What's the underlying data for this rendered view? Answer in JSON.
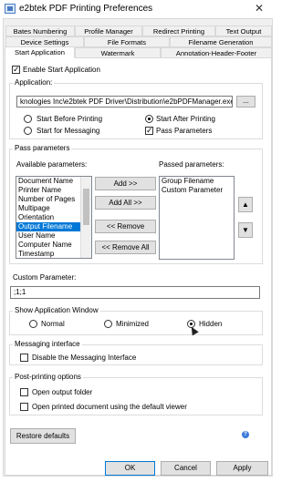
{
  "window": {
    "title": "e2btek PDF Printing Preferences",
    "close": "✕"
  },
  "tabs": {
    "row1": [
      "Bates Numbering",
      "Profile Manager",
      "Redirect Printing",
      "Text Output"
    ],
    "row2": [
      "Device Settings",
      "File Formats",
      "Filename Generation"
    ],
    "row3": [
      "Start Application",
      "Watermark",
      "Annotation-Header-Footer"
    ]
  },
  "enable_start_app": {
    "label": "Enable Start Application",
    "checked": true
  },
  "application": {
    "group_label": "Application:",
    "path": "knologies Inc\\e2btek PDF Driver\\Distribution\\e2bPDFManager.exe",
    "browse": "...",
    "start_before": "Start Before Printing",
    "start_after": "Start After Printing",
    "start_messaging": "Start for Messaging",
    "pass_parameters": "Pass Parameters"
  },
  "pass_params": {
    "group_label": "Pass parameters",
    "available_label": "Available parameters:",
    "passed_label": "Passed parameters:",
    "available": [
      "Document Name",
      "Printer Name",
      "Number of Pages",
      "Multipage",
      "Orientation",
      "Output Filename",
      "User Name",
      "Computer Name",
      "Timestamp"
    ],
    "selected_index": 5,
    "passed": [
      "Group Filename",
      "Custom Parameter"
    ],
    "add": "Add >>",
    "add_all": "Add All >>",
    "remove": "<< Remove",
    "remove_all": "<< Remove All",
    "up": "▲",
    "down": "▼"
  },
  "custom_param": {
    "label": "Custom Parameter:",
    "value": ";1;1"
  },
  "show_window": {
    "group_label": "Show Application Window",
    "normal": "Normal",
    "minimized": "Minimized",
    "hidden": "Hidden"
  },
  "messaging": {
    "group_label": "Messaging interface",
    "disable": "Disable the Messaging Interface"
  },
  "post": {
    "group_label": "Post-printing options",
    "open_folder": "Open output folder",
    "open_doc": "Open printed document using the default viewer"
  },
  "footer": {
    "restore": "Restore defaults",
    "help": "?",
    "ok": "OK",
    "cancel": "Cancel",
    "apply": "Apply"
  }
}
